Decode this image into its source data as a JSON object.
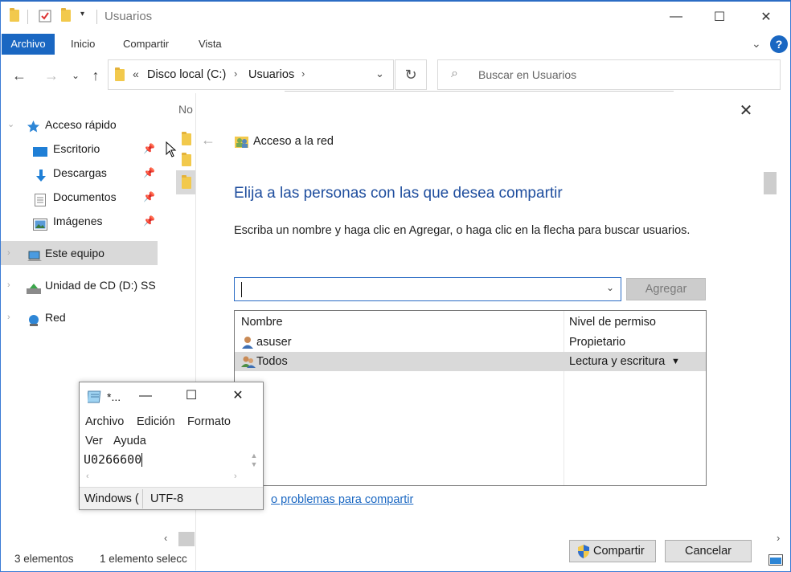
{
  "window": {
    "title": "Usuarios",
    "caption": {
      "minimize": "—",
      "maximize": "☐",
      "close": "✕"
    }
  },
  "ribbon": {
    "tabs": [
      "Archivo",
      "Inicio",
      "Compartir",
      "Vista"
    ],
    "help": "?"
  },
  "address": {
    "prefix": "«",
    "segments": [
      "Disco local (C:)",
      "Usuarios"
    ]
  },
  "search": {
    "placeholder": "Buscar en Usuarios"
  },
  "nav_pane": {
    "quick_access": "Acceso rápido",
    "quick_items": [
      "Escritorio",
      "Descargas",
      "Documentos",
      "Imágenes"
    ],
    "this_pc": "Este equipo",
    "cd_drive": "Unidad de CD (D:) SS",
    "network": "Red"
  },
  "file_list": {
    "column_header": "No"
  },
  "status_bar": {
    "count": "3 elementos",
    "selection": "1 elemento selecc"
  },
  "share_dialog": {
    "nav_title": "Acceso a la red",
    "heading": "Elija a las personas con las que desea compartir",
    "description": "Escriba un nombre y haga clic en Agregar, o haga clic en la flecha para buscar usuarios.",
    "add_button": "Agregar",
    "table_headers": [
      "Nombre",
      "Nivel de permiso"
    ],
    "rows": [
      {
        "name": "asuser",
        "permission": "Propietario"
      },
      {
        "name": "Todos",
        "permission": "Lectura y escritura"
      }
    ],
    "problems_link": "o problemas para compartir",
    "share_button": "Compartir",
    "cancel_button": "Cancelar"
  },
  "notepad": {
    "title": "*...",
    "menu": [
      "Archivo",
      "Edición",
      "Formato",
      "Ver",
      "Ayuda"
    ],
    "text": "U0266600",
    "status_line": "Windows (",
    "status_encoding": "UTF-8"
  },
  "colors": {
    "accent": "#1a67c2",
    "heading": "#1f4e9e",
    "selection": "#d9d9d9"
  }
}
